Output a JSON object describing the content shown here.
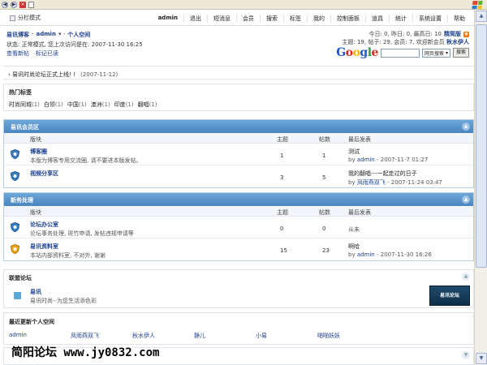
{
  "top": {
    "split_mode": "分栏模式",
    "nav": [
      "admin",
      "退出",
      "短消息",
      "会员",
      "搜索",
      "标签",
      "我的",
      "控制面板",
      "道具",
      "统计",
      "系统设置",
      "帮助"
    ]
  },
  "header": {
    "forum_name": "易讯博客",
    "user": "admin",
    "space": "个人空间",
    "status": "状态: 正常模式, 您上次访问是在: 2007-11-30 16:25",
    "view_new": "查看新帖",
    "mark_read": "标记已读",
    "stats1": "今日: 0, 昨日: 0, 最高日: 10",
    "archiver": "精简版",
    "stats2_prefix": "主题: 19, 帖子: 29, 会员: 7, 欢迎新会员",
    "newest_member": "秋水伊人",
    "search_option": "网页搜索",
    "search_button": "搜索"
  },
  "notice": {
    "text": "易讯时尚论坛正式上线!  !",
    "date": "(2007-11-12)"
  },
  "hot_tags": {
    "title": "热门标签",
    "tags": [
      {
        "name": "时尚同城",
        "count": "(1)"
      },
      {
        "name": "白领",
        "count": "(1)"
      },
      {
        "name": "中国",
        "count": "(1)"
      },
      {
        "name": "澳洲",
        "count": "(1)"
      },
      {
        "name": "印度",
        "count": "(1)"
      },
      {
        "name": "翻唱",
        "count": "(1)"
      }
    ]
  },
  "columns": {
    "forum": "版块",
    "topics": "主题",
    "posts": "帖数",
    "last": "最后发表"
  },
  "sections": [
    {
      "title": "易讯会员区",
      "forums": [
        {
          "name": "博客圈",
          "desc": "本版为博客专用交流圈, 请不要进本版发帖。",
          "topics": "1",
          "posts": "1",
          "last_title": "测试",
          "last_by": "admin",
          "last_time": "- 2007-11-7 01:27"
        },
        {
          "name": "视频分享区",
          "desc": "",
          "topics": "3",
          "posts": "5",
          "last_title": "我的翻唱---一起走过的日子",
          "last_by": "凤雨燕双飞",
          "last_time": "- 2007-11-24 03:47"
        }
      ]
    },
    {
      "title": "新务处理",
      "forums": [
        {
          "name": "论坛办公室",
          "desc": "论坛事务处理, 斑竹申请, 发帖违规申请等",
          "topics": "0",
          "posts": "0",
          "last_title": "",
          "last_by": "",
          "last_time": "",
          "last_text": "从未"
        },
        {
          "name": "易讯资料室",
          "desc": "本站内部资料室, 不对外, 谢谢",
          "topics": "15",
          "posts": "23",
          "last_title": "啊哈",
          "last_by": "admin",
          "last_time": "- 2007-11-30 16:26"
        }
      ]
    }
  ],
  "union": {
    "title": "联盟论坛",
    "name": "易讯",
    "desc": "易讯时尚--为您生活添色彩",
    "banner": "易讯论坛"
  },
  "recent": {
    "title": "最近更新个人空间",
    "users": [
      "admin",
      "凤雨燕双飞",
      "秋水伊人",
      "静儿",
      "小易",
      "啪啪妖妖"
    ]
  },
  "watermark": "简阳论坛 www.jy0832.com",
  "colors": {
    "section_head": "#4a85c0",
    "link": "#1a3f8f",
    "rss": "#f07a12"
  }
}
